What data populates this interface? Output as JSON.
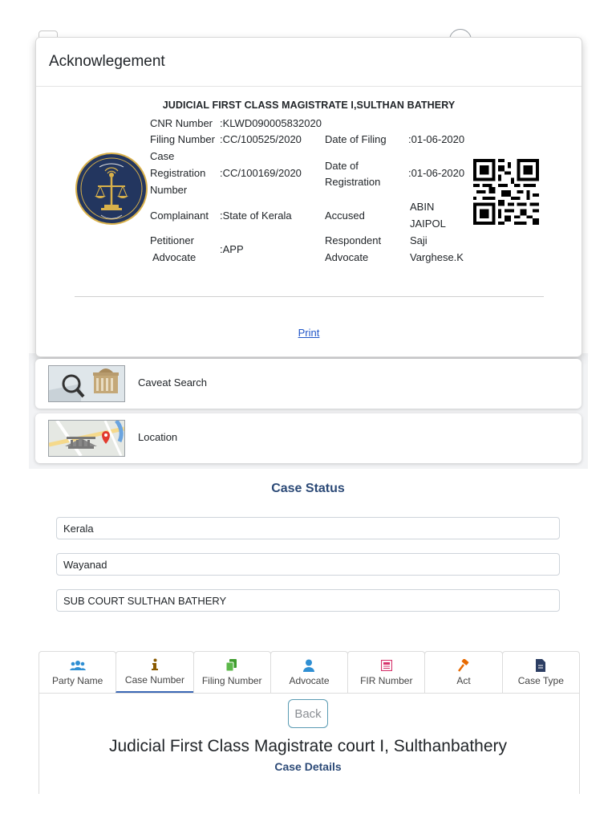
{
  "modal": {
    "title": "Acknowlegement",
    "court": "JUDICIAL FIRST CLASS MAGISTRATE I,SULTHAN BATHERY",
    "cnr_label": "CNR Number",
    "cnr_value": ":KLWD090005832020",
    "filing_label": "Filing Number",
    "filing_value": ":CC/100525/2020",
    "filing_date_label": "Date of Filing",
    "filing_date_value": ":01-06-2020",
    "reg_label_1": "Case",
    "reg_label_2": "Registration",
    "reg_label_3": "Number",
    "reg_value": ":CC/100169/2020",
    "reg_date_label_1": "Date of",
    "reg_date_label_2": "Registration",
    "reg_date_value": ":01-06-2020",
    "complainant_label": "Complainant",
    "complainant_value": ":State of Kerala",
    "accused_label": "Accused",
    "accused_value_1": "ABIN",
    "accused_value_2": "JAIPOL",
    "pet_adv_label_1": "Petitioner",
    "pet_adv_label_2": "Advocate",
    "pet_adv_value": ":APP",
    "resp_adv_label_1": "Respondent",
    "resp_adv_label_2": "Advocate",
    "resp_adv_value_1": "Saji",
    "resp_adv_value_2": "Varghese.K",
    "print_label": "Print"
  },
  "cards": [
    {
      "label": "Caveat Search",
      "icon": "caveat-search-icon"
    },
    {
      "label": "Location",
      "icon": "location-map-icon"
    }
  ],
  "case_status": {
    "title": "Case Status",
    "state": "Kerala",
    "district": "Wayanad",
    "court_complex": "SUB COURT SULTHAN BATHERY"
  },
  "tabs": [
    {
      "label": "Party Name",
      "icon": "users-icon",
      "color": "#2f8fd3"
    },
    {
      "label": "Case Number",
      "icon": "info-icon",
      "color": "#8a5a00"
    },
    {
      "label": "Filing Number",
      "icon": "copy-icon",
      "color": "#3f9d2e"
    },
    {
      "label": "Advocate",
      "icon": "user-icon",
      "color": "#2f8fd3"
    },
    {
      "label": "FIR Number",
      "icon": "newspaper-icon",
      "color": "#d6336c"
    },
    {
      "label": "Act",
      "icon": "gavel-icon",
      "color": "#e86a00"
    },
    {
      "label": "Case Type",
      "icon": "file-icon",
      "color": "#2c3e63"
    }
  ],
  "result": {
    "back_label": "Back",
    "court_name": "Judicial First Class Magistrate court I, Sulthanbathery",
    "details_title": "Case Details"
  }
}
